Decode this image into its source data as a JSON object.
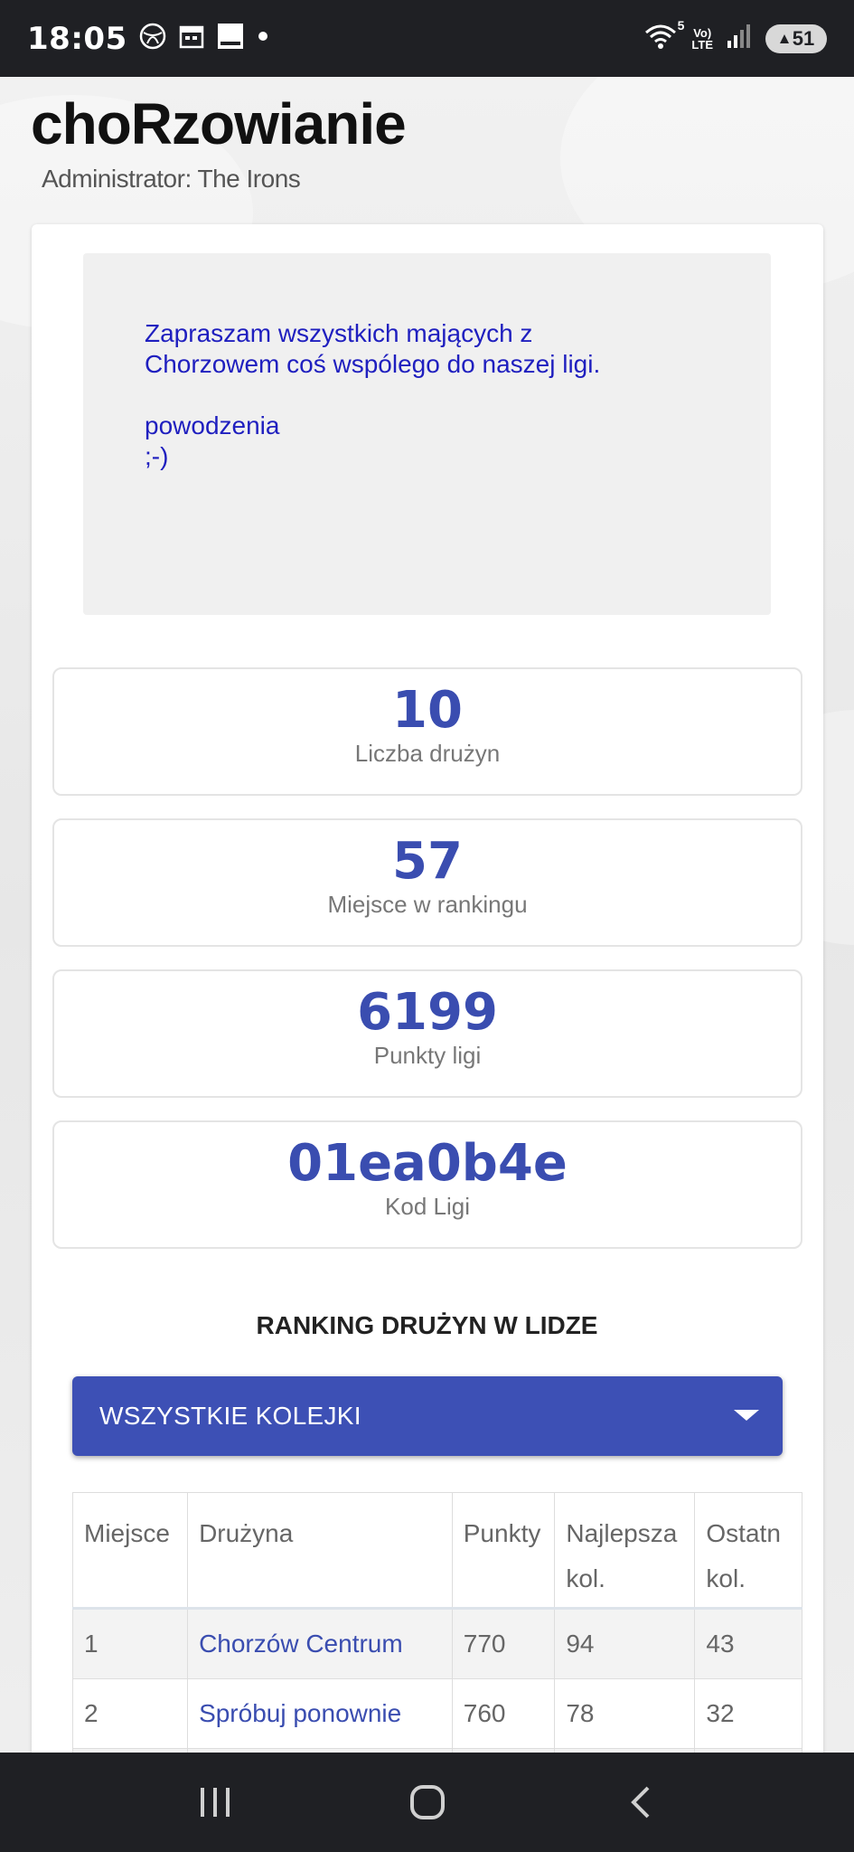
{
  "status_bar": {
    "time": "18:05",
    "network_top": "Vo)",
    "network_bottom": "LTE",
    "wifi_badge": "5",
    "battery": "51",
    "icons": [
      "vpn-globe-icon",
      "calendar-icon",
      "screenshot-icon",
      "dot-icon",
      "wifi-icon",
      "signal-icon",
      "battery-icon"
    ]
  },
  "header": {
    "title": "choRzowianie",
    "admin": "Administrator: The Irons"
  },
  "announcement": {
    "line1": "Zapraszam wszystkich mających z",
    "line2": "Chorzowem coś wspólego do naszej ligi.",
    "line3": "powodzenia",
    "line4": ";-)"
  },
  "stats": [
    {
      "value": "10",
      "label": "Liczba drużyn"
    },
    {
      "value": "57",
      "label": "Miejsce w rankingu"
    },
    {
      "value": "6199",
      "label": "Punkty ligi"
    },
    {
      "value": "01ea0b4e",
      "label": "Kod Ligi"
    }
  ],
  "ranking": {
    "title": "RANKING DRUŻYN W LIDZE",
    "select_value": "WSZYSTKIE KOLEJKI",
    "columns": [
      "Miejsce",
      "Drużyna",
      "Punkty",
      "Najlepsza kol.",
      "Ostatn kol."
    ],
    "rows": [
      {
        "place": "1",
        "team": "Chorzów Centrum",
        "points": "770",
        "best": "94",
        "last": "43"
      },
      {
        "place": "2",
        "team": "Spróbuj ponownie",
        "points": "760",
        "best": "78",
        "last": "32"
      }
    ]
  },
  "colors": {
    "accent": "#3d50b5",
    "stat_value": "#3a4db0",
    "announcement_text": "#1f1fbf",
    "system_bar": "#1f2024"
  }
}
